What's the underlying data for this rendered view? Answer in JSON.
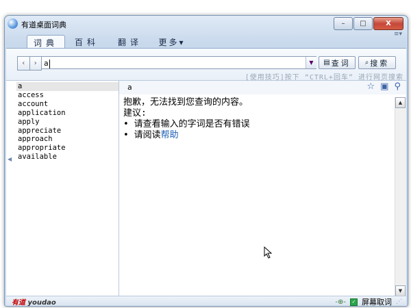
{
  "window": {
    "title": "有道桌面词典",
    "min_label": "–",
    "max_label": "□",
    "close_label": "X"
  },
  "tabs": [
    {
      "label": "词典"
    },
    {
      "label": "百科"
    },
    {
      "label": "翻译"
    },
    {
      "label": "更多▾"
    }
  ],
  "search": {
    "back_label": "‹",
    "forward_label": "›",
    "value": "a",
    "lookup_label": "查词",
    "search_label": "搜索",
    "hint": "[使用技巧]按下 “CTRL+回车” 进行网页搜索"
  },
  "word_list": [
    "a",
    "access",
    "account",
    "application",
    "apply",
    "appreciate",
    "approach",
    "appropriate",
    "available"
  ],
  "result": {
    "word": "a",
    "not_found": "抱歉，无法找到您查询的内容。",
    "suggest_title": "建议:",
    "suggestion1": "请查看输入的字词是否有错误",
    "suggestion2_prefix": "请阅读",
    "suggestion2_link": "帮助"
  },
  "status": {
    "logo_cn": "有道",
    "logo_en": "youdao",
    "screen_capture_label": "屏幕取词"
  },
  "colors": {
    "accent": "#1c5fb5",
    "logo_red": "#c40000",
    "close_red": "#c6483a"
  }
}
